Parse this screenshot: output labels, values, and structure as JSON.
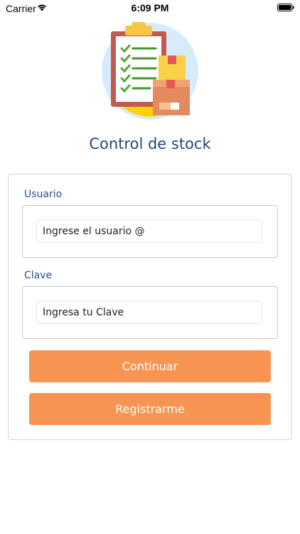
{
  "status_bar": {
    "carrier": "Carrier",
    "time": "6:09 PM"
  },
  "app": {
    "title": "Control de stock"
  },
  "form": {
    "user_label": "Usuario",
    "user_placeholder": "Ingrese el usuario @",
    "user_value": "",
    "pass_label": "Clave",
    "pass_placeholder": "Ingresa tu Clave",
    "pass_value": "",
    "continue_label": "Continuar",
    "register_label": "Registrarme"
  },
  "colors": {
    "title": "#204a79",
    "label": "#2c4f8a",
    "button": "#f79452",
    "button_text": "#ffffff"
  },
  "icons": {
    "hero": "clipboard-boxes-illustration",
    "wifi": "wifi-icon",
    "battery": "battery-icon"
  }
}
